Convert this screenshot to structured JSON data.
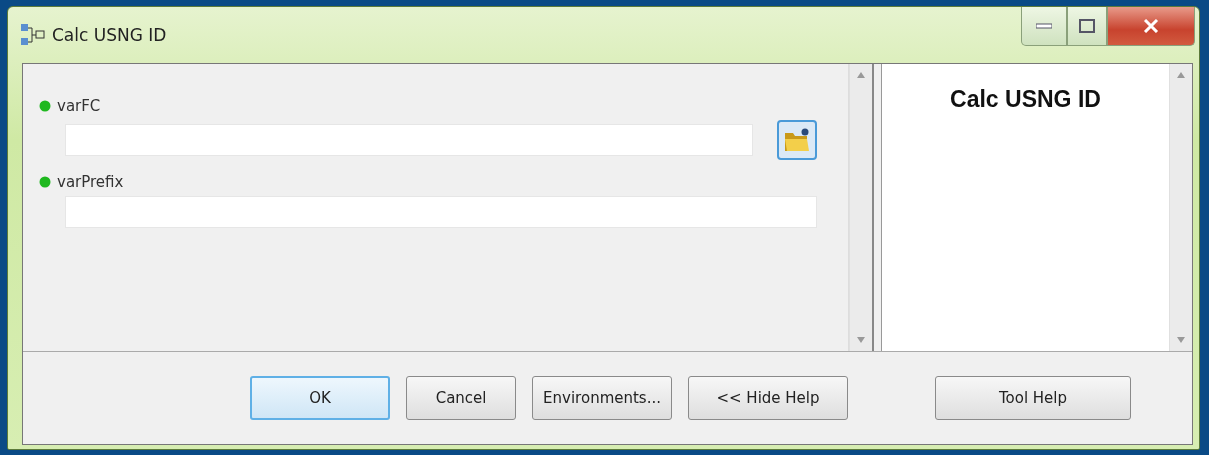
{
  "window": {
    "title": "Calc USNG ID"
  },
  "parameters": [
    {
      "label": "varFC",
      "required": true,
      "kind": "dataset"
    },
    {
      "label": "varPrefix",
      "required": true,
      "kind": "text"
    }
  ],
  "help_panel": {
    "title": "Calc USNG ID"
  },
  "buttons": [
    {
      "label": "OK",
      "default": true,
      "kind": "dialog"
    },
    {
      "label": "Cancel",
      "default": false,
      "kind": "dialog"
    },
    {
      "label": "Environments...",
      "default": false,
      "kind": "dialog"
    },
    {
      "label": "<< Hide Help",
      "default": false,
      "kind": "dialog"
    },
    {
      "label": "Tool Help",
      "default": false,
      "kind": "help"
    }
  ]
}
